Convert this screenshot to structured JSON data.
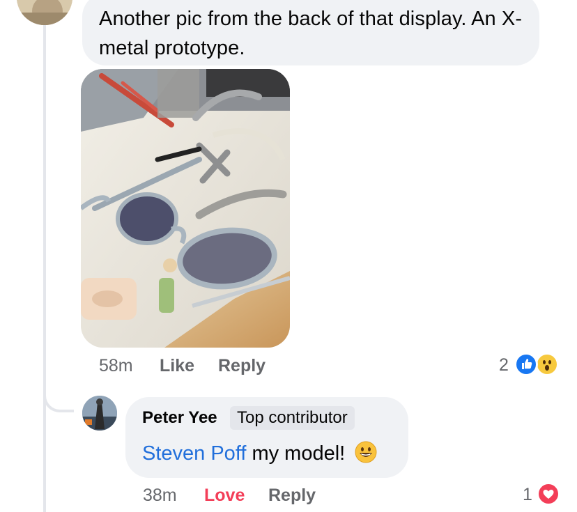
{
  "parent_comment": {
    "text": "Another pic from the back of that display. An X-metal prototype.",
    "time": "58m",
    "like_label": "Like",
    "reply_label": "Reply",
    "reaction_count": "2",
    "reactions": [
      "like-icon",
      "wow-icon"
    ]
  },
  "reply_comment": {
    "author": "Peter Yee",
    "badge": "Top contributor",
    "mention": "Steven Poff",
    "text": "my model!",
    "emoji": "grinning-face-icon",
    "time": "38m",
    "love_label": "Love",
    "reply_label": "Reply",
    "reaction_count": "1",
    "reactions": [
      "love-icon"
    ]
  },
  "colors": {
    "bubble": "#f0f2f5",
    "meta_text": "#65676b",
    "mention": "#216fdb",
    "love": "#f33e58",
    "like": "#1877f2",
    "thread_line": "#e4e6eb"
  }
}
